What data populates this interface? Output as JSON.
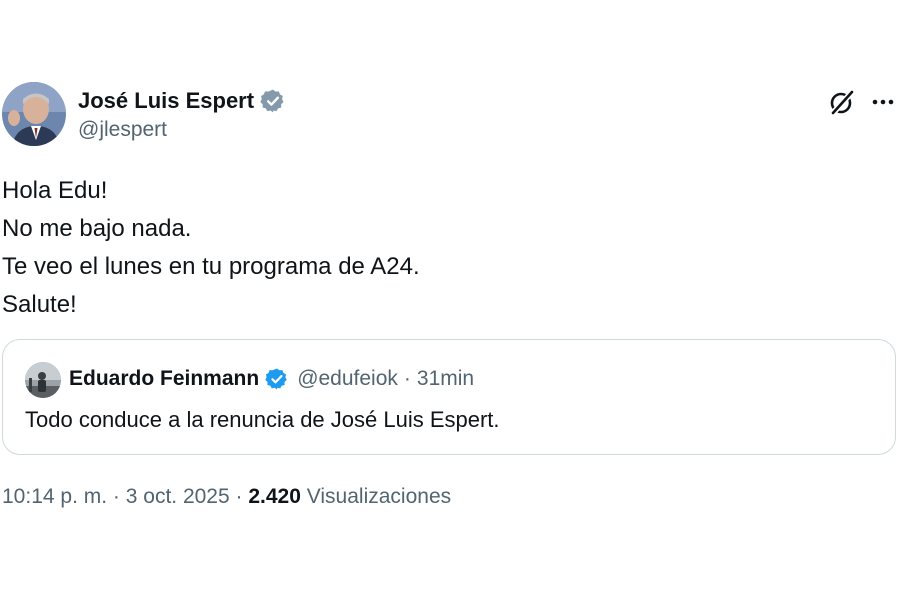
{
  "author": {
    "display_name": "José Luis Espert",
    "handle": "@jlespert",
    "verified_badge": "gray-verified-badge-icon"
  },
  "header_icons": [
    "grok-icon",
    "more-icon"
  ],
  "body": {
    "lines": [
      "Hola Edu!",
      "No me bajo nada.",
      "Te veo el lunes en tu programa de A24.",
      "Salute!"
    ]
  },
  "quoted_tweet": {
    "display_name": "Eduardo Feinmann",
    "handle": "@edufeiok",
    "separator": "·",
    "time": "31min",
    "verified_badge": "blue-verified-badge-icon",
    "text": "Todo conduce a la renuncia de José Luis Espert."
  },
  "meta": {
    "time": "10:14 p. m.",
    "sep1": "·",
    "date": "3 oct. 2025",
    "sep2": "·",
    "views_count": "2.420",
    "views_label": "Visualizaciones"
  },
  "colors": {
    "text_primary": "#0f1419",
    "text_secondary": "#536471",
    "border": "#cfd9de",
    "verified_blue": "#1d9bf0",
    "verified_gray": "#829aab"
  }
}
